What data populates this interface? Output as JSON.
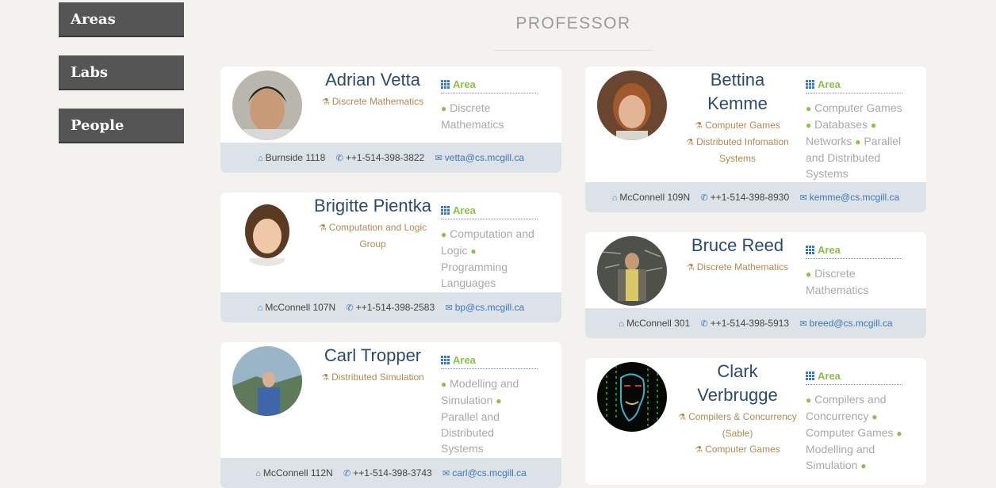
{
  "sidebar": {
    "items": [
      {
        "label": "Areas"
      },
      {
        "label": "Labs"
      },
      {
        "label": "People"
      }
    ]
  },
  "heading": "PROFESSOR",
  "area_label": "Area",
  "people": [
    {
      "name": "Adrian Vetta",
      "groups": [
        "Discrete Mathematics"
      ],
      "areas": [
        "Discrete Mathematics"
      ],
      "office": "Burnside 1118",
      "phone": "++1-514-398-3822",
      "email": "vetta@cs.mcgill.ca"
    },
    {
      "name": "Bettina Kemme",
      "groups": [
        "Computer Games",
        "Distributed Infomation Systems"
      ],
      "areas": [
        "Computer Games",
        "Databases",
        "Networks",
        "Parallel and Distributed Systems"
      ],
      "office": "McConnell 109N",
      "phone": "++1-514-398-8930",
      "email": "kemme@cs.mcgill.ca"
    },
    {
      "name": "Brigitte Pientka",
      "groups": [
        "Computation and Logic Group"
      ],
      "areas": [
        "Computation and Logic",
        "Programming Languages"
      ],
      "office": "McConnell 107N",
      "phone": "++1-514-398-2583",
      "email": "bp@cs.mcgill.ca"
    },
    {
      "name": "Bruce Reed",
      "groups": [
        "Discrete Mathematics"
      ],
      "areas": [
        "Discrete Mathematics"
      ],
      "office": "McConnell 301",
      "phone": "++1-514-398-5913",
      "email": "breed@cs.mcgill.ca"
    },
    {
      "name": "Carl Tropper",
      "groups": [
        "Distributed Simulation"
      ],
      "areas": [
        "Modelling and Simulation",
        "Parallel and Distributed Systems"
      ],
      "office": "McConnell 112N",
      "phone": "++1-514-398-3743",
      "email": "carl@cs.mcgill.ca"
    },
    {
      "name": "Clark Verbrugge",
      "groups": [
        "Compilers & Concurrency (Sable)",
        "Computer Games"
      ],
      "areas": [
        "Compilers and Concurrency",
        "Computer Games",
        "Modelling and Simulation"
      ],
      "office": "",
      "phone": "",
      "email": ""
    }
  ],
  "colors": {
    "page_bg": "#f3f2ef",
    "name": "#2f4a68",
    "group": "#b08a52",
    "area_accent": "#8cc04a",
    "link": "#3d78b8",
    "footer_bg": "#dde1e8",
    "nav_bg": "#555555"
  }
}
